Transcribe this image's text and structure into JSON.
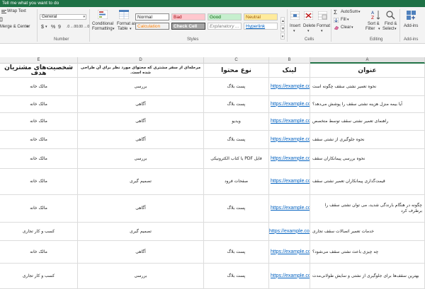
{
  "tellme": "Tell me what you want to do",
  "ribbon": {
    "wrap_text": "Wrap Text",
    "merge_center": "Merge & Center",
    "number_format": "General",
    "dollar": "$",
    "percent": "%",
    "comma": "9",
    "number_label": "Number",
    "conditional_formatting": [
      "Conditional",
      "Formatting"
    ],
    "format_as_table": [
      "Format as",
      "Table"
    ],
    "styles": {
      "normal": "Normal",
      "bad": "Bad",
      "good": "Good",
      "neutral": "Neutral",
      "calculation": "Calculation",
      "check_cell": "Check Cell",
      "explanatory": "Explanatory ...",
      "hyperlink": "Hyperlink"
    },
    "styles_label": "Styles",
    "insert": "Insert",
    "delete": "Delete",
    "format": "Format",
    "cells_label": "Cells",
    "autosum": "AutoSum",
    "fill": "Fill",
    "clear": "Clear",
    "sort_filter": [
      "Sort &",
      "Filter"
    ],
    "find_select": [
      "Find &",
      "Select"
    ],
    "editing_label": "Editing",
    "addins": [
      "Add-ins"
    ],
    "addins_label": "Add-ins"
  },
  "columns": [
    "E",
    "D",
    "C",
    "B",
    "A"
  ],
  "header_row": {
    "a": "عنوان",
    "b": "لینک",
    "c": "نوع محتوا",
    "d": "مرحله‌ای از سفر مشتری که محتوای مورد نظر برای آن طراحی شده است.",
    "e": "شخصیت‌های مشتریان هدف"
  },
  "rows": [
    {
      "a": "نحوه تعمیر نشتی سقف چگونه است",
      "b": "https://example.com",
      "c": "پست بلاگ",
      "d": "بررسی",
      "e": "مالک خانه"
    },
    {
      "a": "آیا بیمه منزل هزینه نشتی سقف را پوشش می‌دهد؟",
      "b": "https://example.com",
      "c": "پست بلاگ",
      "d": "آگاهی",
      "e": "مالک خانه"
    },
    {
      "a": "راهنمای تعمیر نشتی سقف توسط متخصص",
      "b": "https://example.com",
      "c": "ویدیو",
      "d": "آگاهی",
      "e": "مالک خانه"
    },
    {
      "a": "نحوه جلوگیری از نشتی سقف",
      "b": "https://example.com",
      "c": "پست بلاگ",
      "d": "آگاهی",
      "e": "مالک خانه"
    },
    {
      "a": "نحوه بررسی پیمانکاران سقف",
      "b": "https://example.com",
      "c": "فایل PDF یا کتاب الکترونیکی",
      "d": "بررسی",
      "e": "مالک خانه"
    },
    {
      "a": "قیمت‌گذاری پیمانکاران تعمیر نشتی سقف",
      "b": "https://example.com",
      "c": "صفحات فرود",
      "d": "تصمیم گیری",
      "e": "مالک خانه"
    },
    {
      "a": "چگونه در هنگام بارندگی شدید، می توان نشتی سقف را برطرف کرد",
      "b": "https://example.com",
      "c": "پست بلاگ",
      "d": "آگاهی",
      "e": "مالک خانه"
    },
    {
      "a": "خدمات تعمیر اتصالات سقف تجاری",
      "b": "https://example.com",
      "c": "",
      "d": "تصمیم گیری",
      "e": "کسب و کار تجاری"
    },
    {
      "a": "چه چیزی باعث نشتی سقف می‌شود؟",
      "b": "https://example.com",
      "c": "پست بلاگ",
      "d": "آگاهی",
      "e": "مالک خانه"
    },
    {
      "a": "بهترین سقف‌ها برای جلوگیری از نشتی و سایش طولانی‌مدت",
      "b": "https://example.com",
      "c": "پست بلاگ",
      "d": "بررسی",
      "e": "کسب و کار تجاری"
    }
  ]
}
